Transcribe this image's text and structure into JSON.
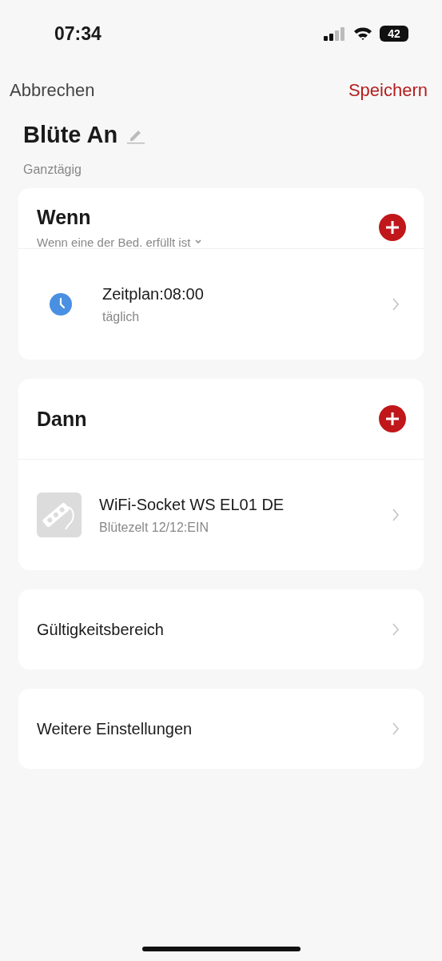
{
  "status_bar": {
    "time": "07:34",
    "battery": "42"
  },
  "nav": {
    "cancel": "Abbrechen",
    "save": "Speichern"
  },
  "scene": {
    "title": "Blüte An",
    "subtitle": "Ganztägig"
  },
  "sections": [
    {
      "title": "Wenn",
      "condition": "Wenn eine der Bed. erfüllt ist",
      "items": [
        {
          "kind": "schedule",
          "title": "Zeitplan:08:00",
          "subtitle": "täglich"
        }
      ]
    },
    {
      "title": "Dann",
      "items": [
        {
          "kind": "device",
          "title": "WiFi-Socket WS EL01 DE",
          "subtitle": "Blütezelt 12/12:EIN"
        }
      ]
    }
  ],
  "settings": [
    "Gültigkeitsbereich",
    "Weitere Einstellungen"
  ]
}
